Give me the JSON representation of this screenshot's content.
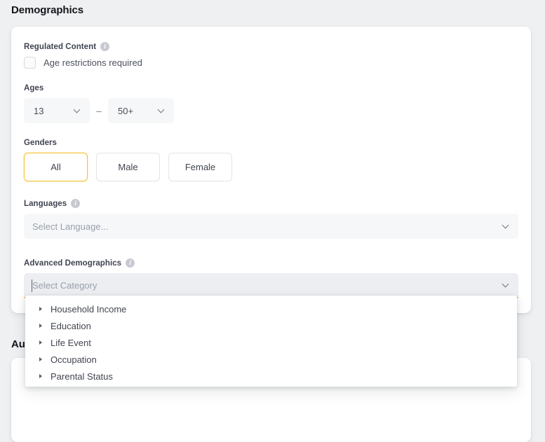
{
  "page": {
    "title": "Demographics",
    "audience_section_title": "Au"
  },
  "regulated_content": {
    "label": "Regulated Content",
    "info_icon": "info-icon",
    "checkbox_label": "Age restrictions required",
    "checked": false
  },
  "ages": {
    "label": "Ages",
    "min_value": "13",
    "max_value": "50+",
    "separator": "–",
    "chevron_icon": "chevron-down-icon"
  },
  "genders": {
    "label": "Genders",
    "options": [
      {
        "label": "All",
        "selected": true
      },
      {
        "label": "Male",
        "selected": false
      },
      {
        "label": "Female",
        "selected": false
      }
    ]
  },
  "languages": {
    "label": "Languages",
    "info_icon": "info-icon",
    "placeholder": "Select Language...",
    "value": "",
    "chevron_icon": "chevron-down-icon"
  },
  "advanced_demographics": {
    "label": "Advanced Demographics",
    "info_icon": "info-icon",
    "placeholder": "Select Category",
    "value": "",
    "focused": true,
    "chevron_icon": "chevron-down-icon",
    "dropdown_items": [
      {
        "label": "Household Income",
        "expand_icon": "triangle-right-icon"
      },
      {
        "label": "Education",
        "expand_icon": "triangle-right-icon"
      },
      {
        "label": "Life Event",
        "expand_icon": "triangle-right-icon"
      },
      {
        "label": "Occupation",
        "expand_icon": "triangle-right-icon"
      },
      {
        "label": "Parental Status",
        "expand_icon": "triangle-right-icon"
      }
    ]
  },
  "colors": {
    "accent_yellow": "#f5c33b",
    "page_background": "#eef0f2",
    "card_background": "#ffffff",
    "field_background": "#f6f7f9"
  }
}
